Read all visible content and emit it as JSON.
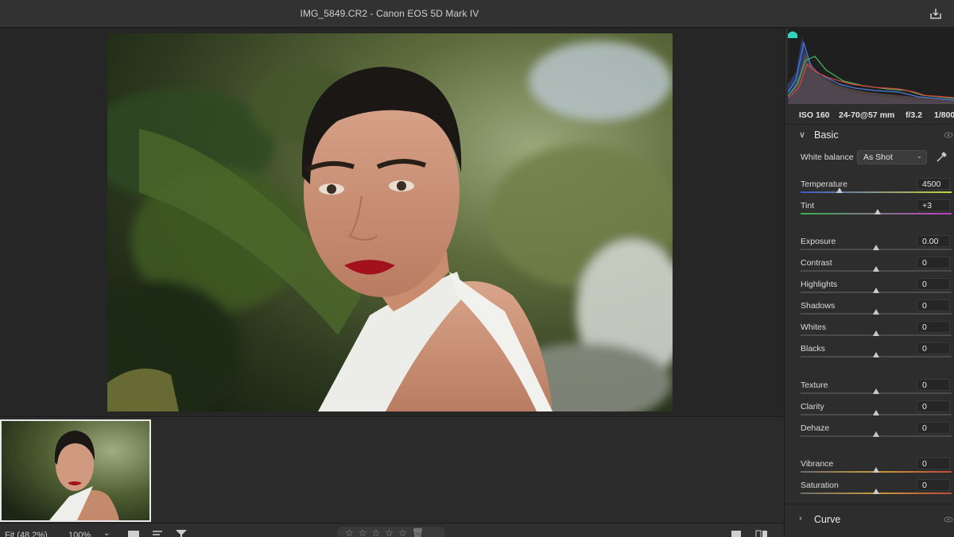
{
  "window": {
    "title": "IMG_5849.CR2  -  Canon EOS 5D Mark IV"
  },
  "metadata": {
    "iso": "ISO 160",
    "lens": "24-70@57 mm",
    "aperture": "f/3.2",
    "shutter": "1/800"
  },
  "basic": {
    "label": "Basic",
    "white_balance_label": "White balance",
    "white_balance_value": "As Shot",
    "sliders": [
      {
        "label": "Temperature",
        "value": "4500",
        "position": 0.26
      },
      {
        "label": "Tint",
        "value": "+3",
        "position": 0.51
      },
      {
        "label": "Exposure",
        "value": "0.00",
        "position": 0.5
      },
      {
        "label": "Contrast",
        "value": "0",
        "position": 0.5
      },
      {
        "label": "Highlights",
        "value": "0",
        "position": 0.5
      },
      {
        "label": "Shadows",
        "value": "0",
        "position": 0.5
      },
      {
        "label": "Whites",
        "value": "0",
        "position": 0.5
      },
      {
        "label": "Blacks",
        "value": "0",
        "position": 0.5
      },
      {
        "label": "Texture",
        "value": "0",
        "position": 0.5
      },
      {
        "label": "Clarity",
        "value": "0",
        "position": 0.5
      },
      {
        "label": "Dehaze",
        "value": "0",
        "position": 0.5
      },
      {
        "label": "Vibrance",
        "value": "0",
        "position": 0.5
      },
      {
        "label": "Saturation",
        "value": "0",
        "position": 0.5
      }
    ]
  },
  "curve": {
    "label": "Curve"
  },
  "bottom_bar": {
    "fit": "Fit (48.2%)",
    "zoom": "100%",
    "stars": [
      "☆",
      "☆",
      "☆",
      "☆",
      "☆"
    ]
  },
  "colors": {
    "panel_bg": "#2d2d2d",
    "title_bar": "#323232",
    "clip_warning": "#2fd3c0"
  }
}
